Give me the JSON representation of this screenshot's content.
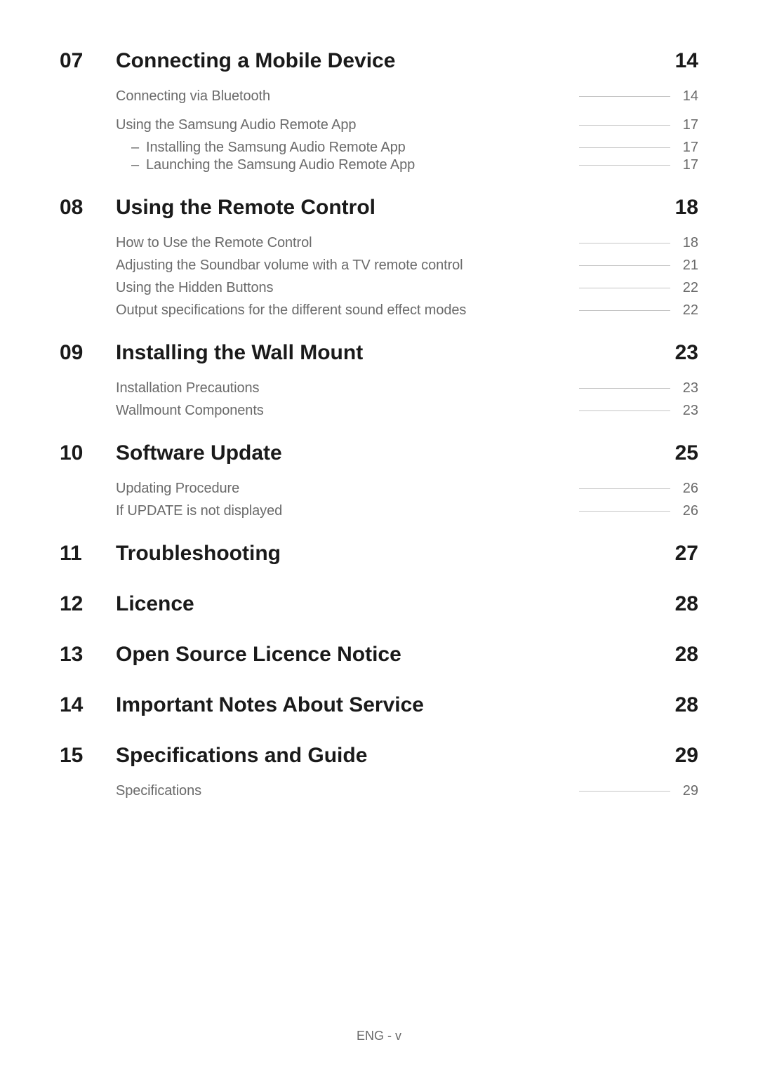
{
  "footer": "ENG - v",
  "sections": [
    {
      "number": "07",
      "title": "Connecting a Mobile Device",
      "page": "14",
      "items": [
        {
          "text": "Connecting via Bluetooth",
          "page": "14",
          "type": "item",
          "grouped": false
        },
        {
          "text": "Using the Samsung Audio Remote App",
          "page": "17",
          "type": "item",
          "grouped": true
        },
        {
          "text": "Installing the Samsung Audio Remote App",
          "page": "17",
          "type": "sub"
        },
        {
          "text": "Launching the Samsung Audio Remote App",
          "page": "17",
          "type": "sub"
        }
      ]
    },
    {
      "number": "08",
      "title": "Using the Remote Control",
      "page": "18",
      "items": [
        {
          "text": "How to Use the Remote Control",
          "page": "18",
          "type": "item"
        },
        {
          "text": "Adjusting the Soundbar volume with a TV remote control",
          "page": "21",
          "type": "item"
        },
        {
          "text": "Using the Hidden Buttons",
          "page": "22",
          "type": "item"
        },
        {
          "text": "Output specifications for the different sound effect modes",
          "page": "22",
          "type": "item"
        }
      ]
    },
    {
      "number": "09",
      "title": "Installing the Wall Mount",
      "page": "23",
      "items": [
        {
          "text": "Installation Precautions",
          "page": "23",
          "type": "item"
        },
        {
          "text": "Wallmount Components",
          "page": "23",
          "type": "item"
        }
      ]
    },
    {
      "number": "10",
      "title": "Software Update",
      "page": "25",
      "items": [
        {
          "text": "Updating Procedure",
          "page": "26",
          "type": "item"
        },
        {
          "text": "If UPDATE is not displayed",
          "page": "26",
          "type": "item"
        }
      ]
    },
    {
      "number": "11",
      "title": "Troubleshooting",
      "page": "27",
      "items": []
    },
    {
      "number": "12",
      "title": "Licence",
      "page": "28",
      "items": []
    },
    {
      "number": "13",
      "title": "Open Source Licence Notice",
      "page": "28",
      "items": []
    },
    {
      "number": "14",
      "title": "Important Notes About Service",
      "page": "28",
      "items": []
    },
    {
      "number": "15",
      "title": "Specifications and Guide",
      "page": "29",
      "items": [
        {
          "text": "Specifications",
          "page": "29",
          "type": "item"
        }
      ]
    }
  ]
}
